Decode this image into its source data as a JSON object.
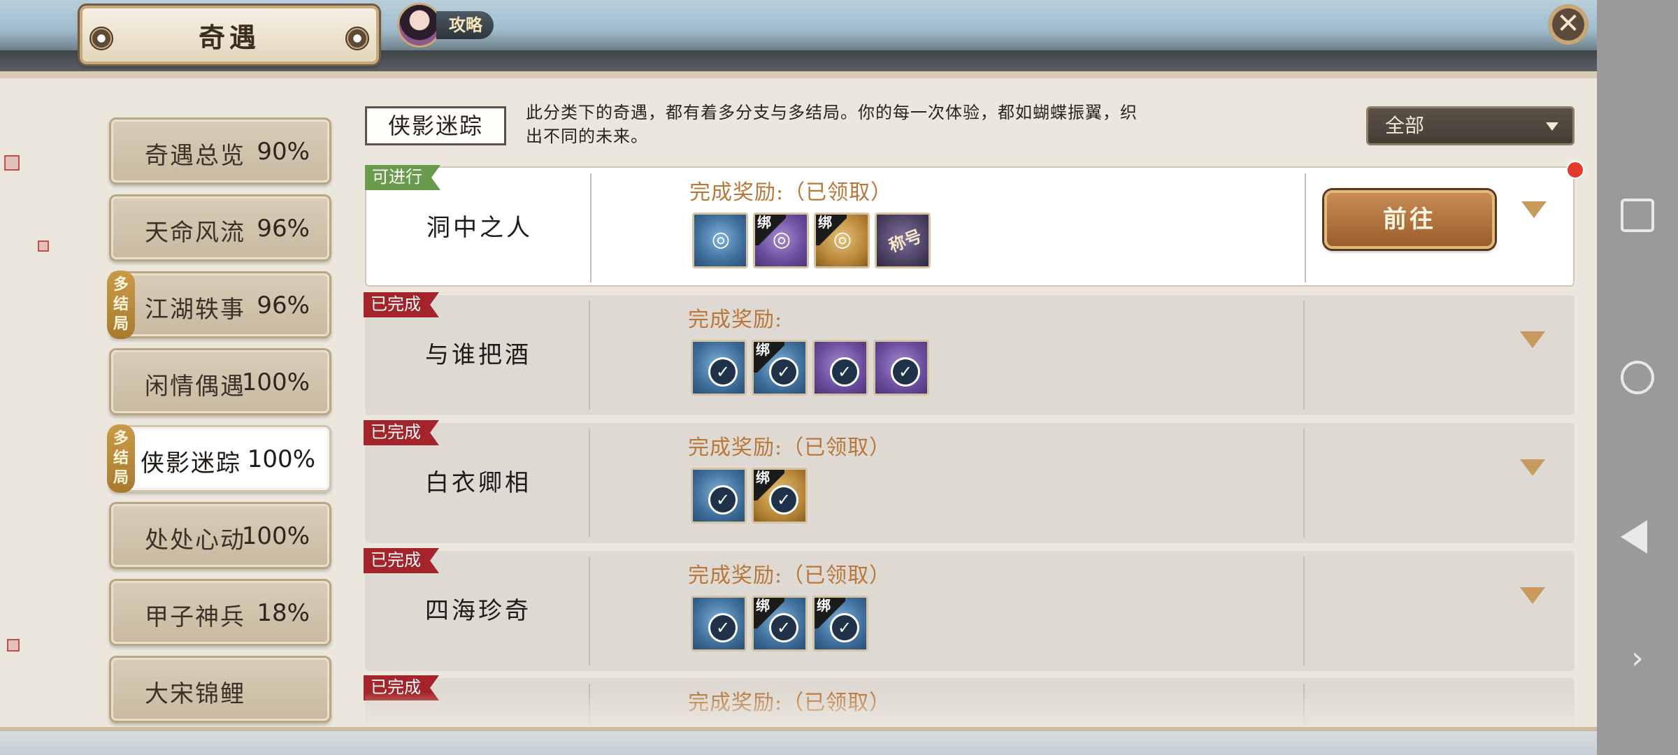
{
  "header": {
    "title": "奇遇",
    "guide_label": "攻略",
    "close_glyph": "✕"
  },
  "menu": [
    {
      "label": "奇遇总览",
      "percent": "90%",
      "multi": false,
      "active": false
    },
    {
      "label": "天命风流",
      "percent": "96%",
      "multi": false,
      "active": false
    },
    {
      "label": "江湖轶事",
      "percent": "96%",
      "multi": true,
      "active": false
    },
    {
      "label": "闲情偶遇",
      "percent": "100%",
      "multi": false,
      "active": false
    },
    {
      "label": "侠影迷踪",
      "percent": "100%",
      "multi": true,
      "active": true
    },
    {
      "label": "处处心动",
      "percent": "100%",
      "multi": false,
      "active": false
    },
    {
      "label": "甲子神兵",
      "percent": "18%",
      "multi": false,
      "active": false
    },
    {
      "label": "大宋锦鲤",
      "percent": "",
      "multi": false,
      "active": false
    }
  ],
  "multi_tag": "多结局",
  "category": {
    "name": "侠影迷踪",
    "description": "此分类下的奇遇，都有着多分支与多结局。你的每一次体验，都如蝴蝶振翼，织出不同的未来。"
  },
  "filter": {
    "selected": "全部"
  },
  "quests": [
    {
      "status": "可进行",
      "status_type": "ok",
      "name": "洞中之人",
      "reward_title": "完成奖励:（已领取）",
      "items": [
        {
          "color": "blue",
          "bound": false,
          "icon": "ring-icon",
          "claimed": false
        },
        {
          "color": "purple",
          "bound": true,
          "icon": "red-charm-icon",
          "claimed": false
        },
        {
          "color": "gold",
          "bound": true,
          "icon": "pendant-icon",
          "claimed": false
        },
        {
          "color": "dark",
          "bound": false,
          "icon": "title-plaque-icon",
          "text": "称号",
          "claimed": false
        }
      ],
      "action": "前往",
      "has_notice": true
    },
    {
      "status": "已完成",
      "status_type": "done",
      "name": "与谁把酒",
      "reward_title": "完成奖励:",
      "items": [
        {
          "color": "blue",
          "bound": false,
          "claimed": true
        },
        {
          "color": "blue",
          "bound": true,
          "claimed": true
        },
        {
          "color": "purple",
          "bound": false,
          "claimed": true
        },
        {
          "color": "purple",
          "bound": false,
          "claimed": true
        }
      ]
    },
    {
      "status": "已完成",
      "status_type": "done",
      "name": "白衣卿相",
      "reward_title": "完成奖励:（已领取）",
      "items": [
        {
          "color": "blue",
          "bound": false,
          "claimed": true
        },
        {
          "color": "gold",
          "bound": true,
          "claimed": true
        }
      ]
    },
    {
      "status": "已完成",
      "status_type": "done",
      "name": "四海珍奇",
      "reward_title": "完成奖励:（已领取）",
      "items": [
        {
          "color": "blue",
          "bound": false,
          "claimed": true
        },
        {
          "color": "blue",
          "bound": true,
          "claimed": true
        },
        {
          "color": "blue",
          "bound": true,
          "claimed": true
        }
      ]
    },
    {
      "status": "已完成",
      "status_type": "done",
      "name": "",
      "reward_title": "完成奖励:（已领取）",
      "items": []
    }
  ],
  "bind_label": "绑",
  "check_glyph": "✓",
  "colors": {
    "accent_gold": "#b9773a",
    "done_red": "#a3242b",
    "ok_green": "#6a9a4c"
  }
}
